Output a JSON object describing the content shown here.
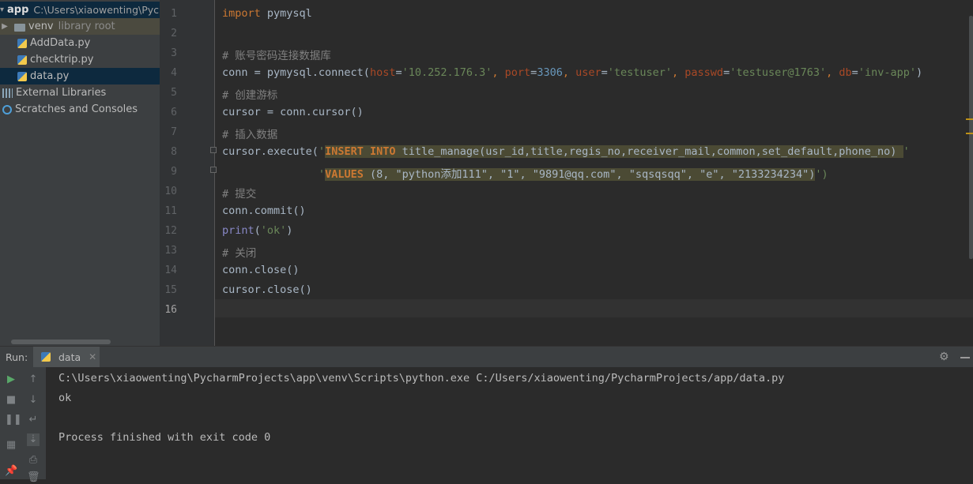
{
  "project": {
    "root_name": "app",
    "root_path": "C:\\Users\\xiaowenting\\Pych",
    "venv_name": "venv",
    "venv_hint": "library root",
    "files": [
      "AddData.py",
      "checktrip.py",
      "data.py"
    ],
    "external_libraries": "External Libraries",
    "scratches": "Scratches and Consoles"
  },
  "editor": {
    "line_numbers": [
      "1",
      "2",
      "3",
      "4",
      "5",
      "6",
      "7",
      "8",
      "9",
      "10",
      "11",
      "12",
      "13",
      "14",
      "15",
      "16"
    ],
    "l1_kw": "import",
    "l1_mod": " pymysql",
    "l3_comment": "# 账号密码连接数据库",
    "l4_a": "conn = pymysql.connect(",
    "l4_host_k": "host",
    "l4_host_v": "'10.252.176.3'",
    "l4_port_k": "port",
    "l4_port_v": "3306",
    "l4_user_k": "user",
    "l4_user_v": "'testuser'",
    "l4_pw_k": "passwd",
    "l4_pw_v": "'testuser@1763'",
    "l4_db_k": "db",
    "l4_db_v": "'inv-app'",
    "l5_comment": "# 创建游标",
    "l6": "cursor = conn.cursor()",
    "l7_comment": "# 插入数据",
    "l8_a": "cursor.execute(",
    "l8_q": "'",
    "l8_sql_kw": "INSERT INTO",
    "l8_sql_rest": " title_manage(usr_id,title,regis_no,receiver_mail,common,set_default,phone_no) ",
    "l8_q2": "'",
    "l9_q": "'",
    "l9_sql_kw": "VALUES",
    "l9_sql_rest": " (8, \"python添加111\", \"1\", \"9891@qq.com\", \"sqsqsqq\", \"e\", \"2133234234\")",
    "l9_end": "')",
    "l10_comment": "# 提交",
    "l11": "conn.commit()",
    "l12_fn": "print",
    "l12_str": "'ok'",
    "l13_comment": "# 关闭",
    "l14": "conn.close()",
    "l15": "cursor.close()"
  },
  "run": {
    "label": "Run:",
    "tab": "data",
    "console": [
      "C:\\Users\\xiaowenting\\PycharmProjects\\app\\venv\\Scripts\\python.exe C:/Users/xiaowenting/PycharmProjects/app/data.py",
      "ok",
      "Process finished with exit code 0"
    ]
  },
  "colors": {
    "keyword": "#cc7832",
    "comment": "#808080",
    "string": "#6a8759",
    "number": "#6897bb",
    "kwarg": "#aa4926",
    "sql_highlight": "#4b4a34"
  },
  "icons": [
    "folder-icon",
    "python-file-icon",
    "library-icon",
    "scratches-icon",
    "rerun-icon",
    "stop-icon",
    "gear-icon"
  ]
}
